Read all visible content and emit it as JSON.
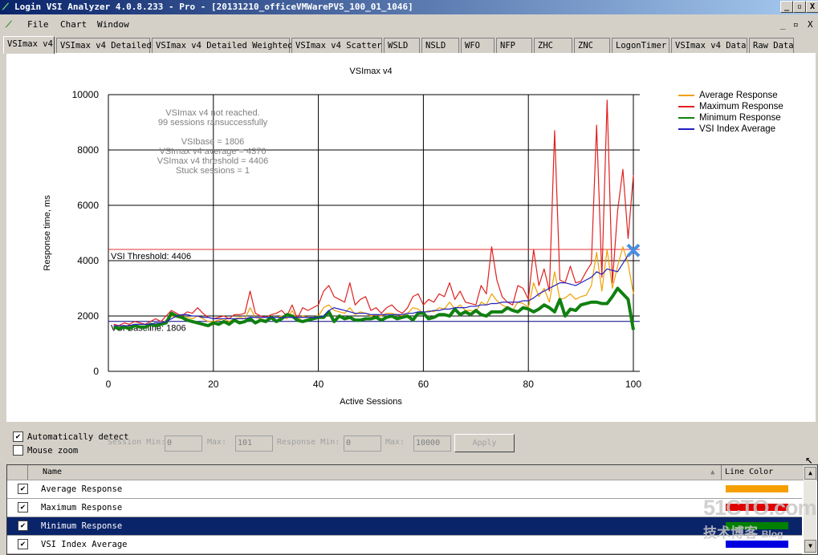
{
  "window": {
    "title": "Login VSI Analyzer 4.0.8.233 - Pro - [20131210_officeVMWarePVS_100_01_1046]",
    "min": "_",
    "max": "▫",
    "close": "X"
  },
  "menu": {
    "items": [
      "File",
      "Chart",
      "Window"
    ],
    "min": "_",
    "restore": "▫",
    "close": "X"
  },
  "tabs": [
    "VSImax v4",
    "VSImax v4 Detailed",
    "VSImax v4 Detailed Weighted",
    "VSImax v4 Scatter",
    "WSLD",
    "NSLD",
    "WFO",
    "NFP",
    "ZHC",
    "ZNC",
    "LogonTimer",
    "VSImax v4 Data",
    "Raw Data"
  ],
  "chart_data": {
    "type": "line",
    "title": "VSImax v4",
    "xlabel": "Active Sessions",
    "ylabel": "Response time, ms",
    "xlim": [
      0,
      100
    ],
    "ylim": [
      0,
      10000
    ],
    "xticks": [
      0,
      20,
      40,
      60,
      80,
      100
    ],
    "yticks": [
      0,
      2000,
      4000,
      6000,
      8000,
      10000
    ],
    "grid": true,
    "legend": "top-right",
    "annotation": [
      "VSImax v4 not reached.",
      "99 sessions ransuccessfully",
      "",
      "VSIbase = 1806",
      "VSImax v4 average = 4370",
      "VSImax v4 threshold = 4406",
      "Stuck sessions = 1"
    ],
    "threshold": {
      "label": "VSI Threshold: 4406",
      "value": 4406,
      "color": "#e03030"
    },
    "baseline": {
      "label": "VSI Baseline: 1806",
      "value": 1806,
      "color": "#000080"
    },
    "vsimax_marker": {
      "x": 100,
      "y": 4370,
      "color": "#4a90e2"
    },
    "series": [
      {
        "name": "Average Response",
        "color": "#f0a000",
        "values": [
          1600,
          1600,
          1650,
          1600,
          1650,
          1650,
          1600,
          1650,
          1700,
          1700,
          1850,
          2000,
          1950,
          1900,
          1950,
          1900,
          2000,
          1900,
          1800,
          1800,
          1850,
          1900,
          1800,
          1900,
          1950,
          1900,
          2300,
          1950,
          1900,
          1850,
          1900,
          1950,
          2000,
          1900,
          2200,
          1850,
          2000,
          1950,
          1950,
          2000,
          2300,
          2400,
          2200,
          2150,
          2100,
          2300,
          2050,
          2150,
          2100,
          2000,
          2050,
          2000,
          2100,
          2100,
          2050,
          2000,
          2100,
          2300,
          2250,
          2100,
          2200,
          2150,
          2300,
          2250,
          2500,
          2250,
          2400,
          2200,
          2200,
          2150,
          2500,
          2400,
          2800,
          2550,
          2400,
          2300,
          2200,
          2500,
          2450,
          2300,
          3200,
          2700,
          3000,
          2500,
          3600,
          2600,
          2650,
          2800,
          2600,
          2700,
          2750,
          3100,
          4300,
          2900,
          4400,
          3000,
          3800,
          4500,
          3900,
          2800
        ]
      },
      {
        "name": "Maximum Response",
        "color": "#e02020",
        "values": [
          1700,
          1650,
          1750,
          1700,
          1800,
          1750,
          1700,
          1800,
          1900,
          1800,
          2000,
          2200,
          2100,
          2000,
          2150,
          2100,
          2300,
          2100,
          1950,
          1900,
          1950,
          2000,
          1900,
          2050,
          2050,
          2100,
          2900,
          2100,
          2000,
          1950,
          2050,
          2100,
          2200,
          2000,
          2400,
          1900,
          2300,
          2200,
          2300,
          2400,
          2900,
          3100,
          2700,
          2600,
          2500,
          3200,
          2400,
          2600,
          2700,
          2200,
          2300,
          2100,
          2300,
          2400,
          2200,
          2100,
          2300,
          2700,
          2800,
          2400,
          2600,
          2500,
          2800,
          2700,
          3200,
          2600,
          2900,
          2500,
          2450,
          2400,
          3100,
          2800,
          4500,
          3300,
          2700,
          2500,
          2400,
          3100,
          3000,
          2600,
          4400,
          3100,
          3700,
          2900,
          8700,
          3300,
          3200,
          3800,
          3200,
          3250,
          3600,
          3900,
          8900,
          3400,
          9800,
          3200,
          5800,
          7300,
          4800,
          7100
        ]
      },
      {
        "name": "Minimum Response",
        "color": "#108010",
        "values": [
          1600,
          1550,
          1600,
          1550,
          1650,
          1600,
          1600,
          1700,
          1650,
          1700,
          1750,
          2100,
          2000,
          1950,
          1850,
          1800,
          1750,
          1700,
          1650,
          1750,
          1700,
          1800,
          1700,
          1850,
          1750,
          1800,
          1900,
          1750,
          1850,
          1800,
          1950,
          1800,
          1900,
          2050,
          2000,
          1850,
          1800,
          1850,
          1900,
          1950,
          1950,
          2150,
          1800,
          2000,
          1900,
          1950,
          1850,
          1850,
          1900,
          1900,
          1950,
          1850,
          1950,
          2000,
          1900,
          1950,
          2000,
          1850,
          2100,
          2100,
          1900,
          1950,
          2050,
          2050,
          2000,
          2250,
          2050,
          2150,
          2050,
          2200,
          2050,
          2000,
          2150,
          2150,
          2150,
          2300,
          2200,
          2150,
          2300,
          2250,
          2150,
          2250,
          2400,
          2300,
          2150,
          2600,
          2000,
          2250,
          2200,
          2400,
          2450,
          2500,
          2500,
          2450,
          2450,
          2700,
          3000,
          2800,
          2600,
          1500
        ]
      },
      {
        "name": "VSI Index Average",
        "color": "#2020c0",
        "values": [
          1650,
          1650,
          1650,
          1650,
          1700,
          1700,
          1700,
          1700,
          1750,
          1750,
          1800,
          1900,
          2000,
          2050,
          2050,
          2000,
          2000,
          1950,
          1950,
          1900,
          1900,
          1900,
          1900,
          1900,
          1900,
          1900,
          1950,
          1950,
          1950,
          1950,
          1950,
          1950,
          1950,
          1950,
          1950,
          1950,
          1950,
          1950,
          1950,
          1950,
          2000,
          2200,
          2300,
          2250,
          2200,
          2150,
          2100,
          2100,
          2100,
          2050,
          2050,
          2050,
          2050,
          2050,
          2050,
          2050,
          2100,
          2100,
          2150,
          2150,
          2150,
          2200,
          2200,
          2250,
          2250,
          2300,
          2300,
          2300,
          2350,
          2350,
          2400,
          2400,
          2450,
          2450,
          2500,
          2500,
          2500,
          2500,
          2550,
          2550,
          2650,
          2800,
          2900,
          3000,
          3100,
          3200,
          3200,
          3150,
          3100,
          3200,
          3300,
          3400,
          3600,
          3500,
          3700,
          3650,
          3600,
          3900,
          4200,
          4400
        ]
      }
    ]
  },
  "controls": {
    "auto_detect": "Automatically detect",
    "auto_detect_checked": true,
    "mouse_zoom": "Mouse zoom",
    "mouse_zoom_checked": false,
    "session_min_label": "Session Min:",
    "session_min": "0",
    "max_label": "Max:",
    "session_max": "101",
    "response_min_label": "Response Min:",
    "response_min": "0",
    "response_max_label": "Max:",
    "response_max": "10000",
    "apply": "Apply"
  },
  "list": {
    "col_name": "Name",
    "col_color": "Line Color",
    "sort_icon": "▲",
    "rows": [
      {
        "name": "Average Response",
        "checked": true,
        "color": "#f5a000"
      },
      {
        "name": "Maximum Response",
        "checked": true,
        "color": "#e00000"
      },
      {
        "name": "Minimum Response",
        "checked": true,
        "color": "#008000",
        "selected": true
      },
      {
        "name": "VSI Index Average",
        "checked": true,
        "color": "#0000e0"
      }
    ]
  },
  "watermark": {
    "text": "51CTO.com 技术博客 Blog"
  }
}
